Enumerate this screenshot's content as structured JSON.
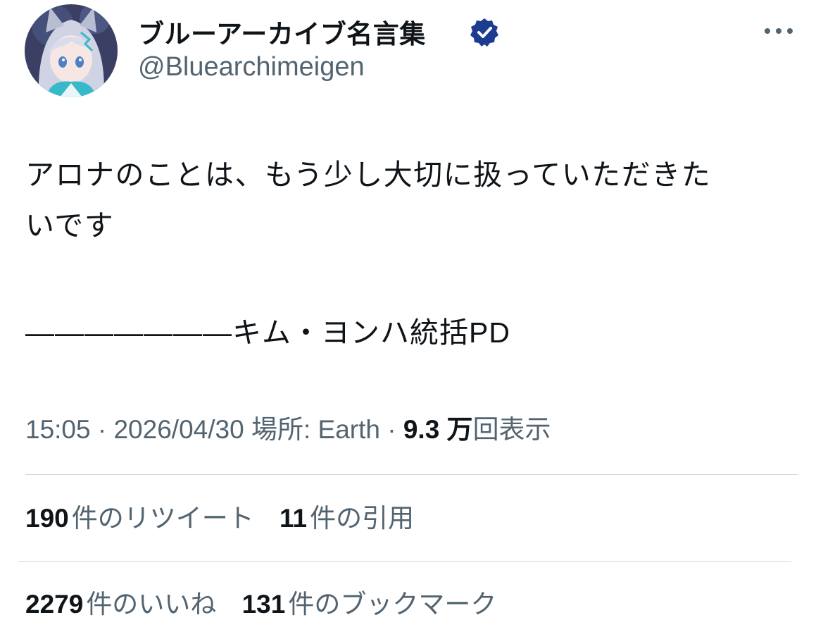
{
  "author": {
    "display_name": "ブルーアーカイブ名言集",
    "handle": "@Bluearchimeigen",
    "verified_icon": "verified-badge-icon",
    "avatar_colors": {
      "background": "#3a3f63",
      "hair": "#cfd3e3",
      "accent": "#36b9c9"
    }
  },
  "tweet": {
    "text": "アロナのことは、もう少し大切に扱っていただきた\nいです",
    "attribution": "———————キム・ヨンハ統括PD"
  },
  "meta": {
    "time": "15:05",
    "separator1": "·",
    "date": "2026/04/30",
    "location_label": "場所: Earth",
    "separator2": "·",
    "views_count": "9.3 万",
    "views_label": "回表示"
  },
  "stats": {
    "retweets": {
      "count": "190",
      "label": "件のリツイート"
    },
    "quotes": {
      "count": "11",
      "label": "件の引用"
    },
    "likes": {
      "count": "2279",
      "label": "件のいいね"
    },
    "bookmarks": {
      "count": "131",
      "label": "件のブックマーク"
    }
  },
  "colors": {
    "text": "#0f1419",
    "secondary": "#536471",
    "divider": "#cfd9de",
    "verified": "#1d3b8f"
  },
  "icons": {
    "more": "more-options-icon"
  }
}
